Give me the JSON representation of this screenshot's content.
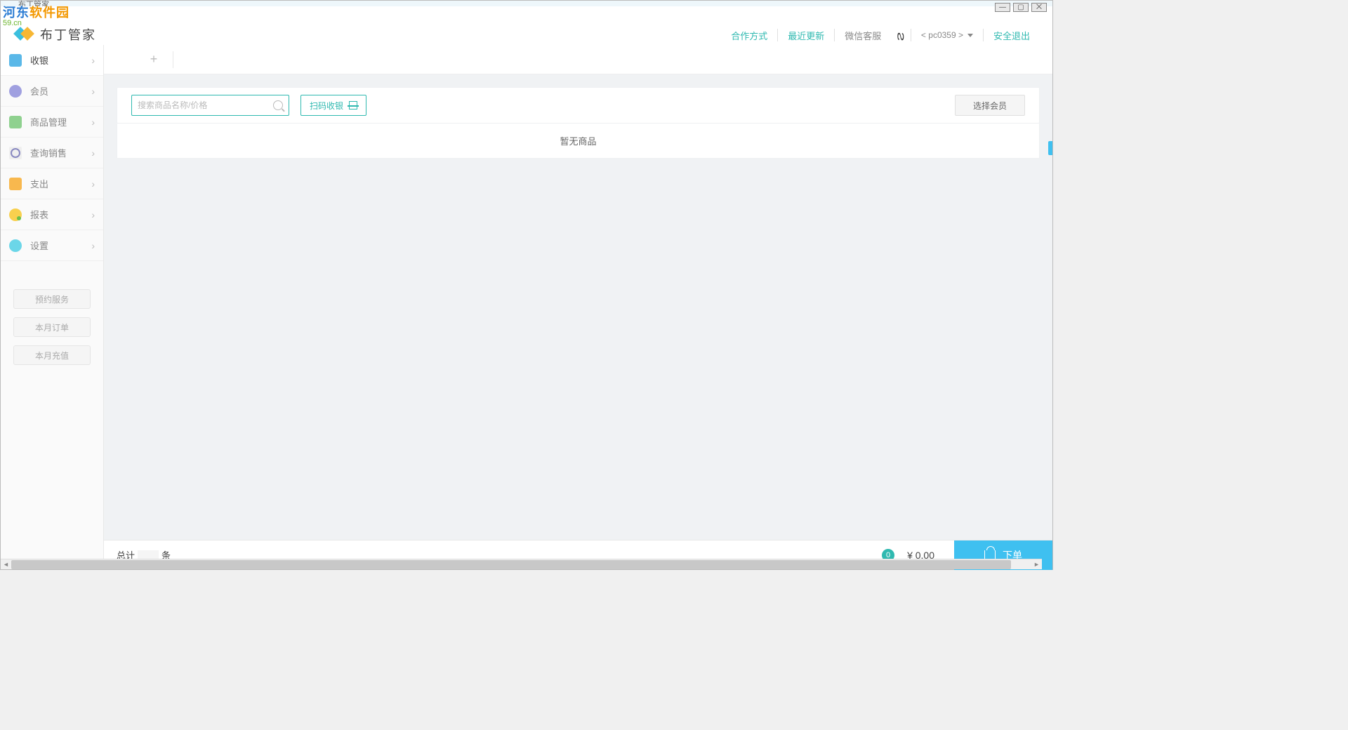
{
  "watermark": {
    "text1": "河东",
    "text2": "软件园",
    "sub": "59.cn"
  },
  "titlebar": {
    "text": "布丁管家"
  },
  "app": {
    "name": "布丁管家"
  },
  "header": {
    "links": {
      "coop": "合作方式",
      "updates": "最近更新",
      "wechat": "微信客服"
    },
    "account": "< pc0359 >",
    "logout": "安全退出"
  },
  "sidebar": {
    "items": [
      {
        "label": "收银",
        "icon": "ic-blue",
        "active": true
      },
      {
        "label": "会员",
        "icon": "ic-purple"
      },
      {
        "label": "商品管理",
        "icon": "ic-green"
      },
      {
        "label": "查询销售",
        "icon": "ic-search"
      },
      {
        "label": "支出",
        "icon": "ic-orange"
      },
      {
        "label": "报表",
        "icon": "ic-yellow"
      },
      {
        "label": "设置",
        "icon": "ic-gear"
      }
    ],
    "actions": {
      "reserve": "预约服务",
      "month_order": "本月订单",
      "month_recharge": "本月充值"
    }
  },
  "toolbar": {
    "search_placeholder": "搜索商品名称/价格",
    "scan_label": "扫码收银",
    "select_member": "选择会员"
  },
  "content": {
    "empty": "暂无商品"
  },
  "footer": {
    "total_prefix": "总计",
    "total_suffix": "条",
    "badge": "0",
    "price_symbol": "¥",
    "price": "0.00",
    "order": "下单"
  }
}
